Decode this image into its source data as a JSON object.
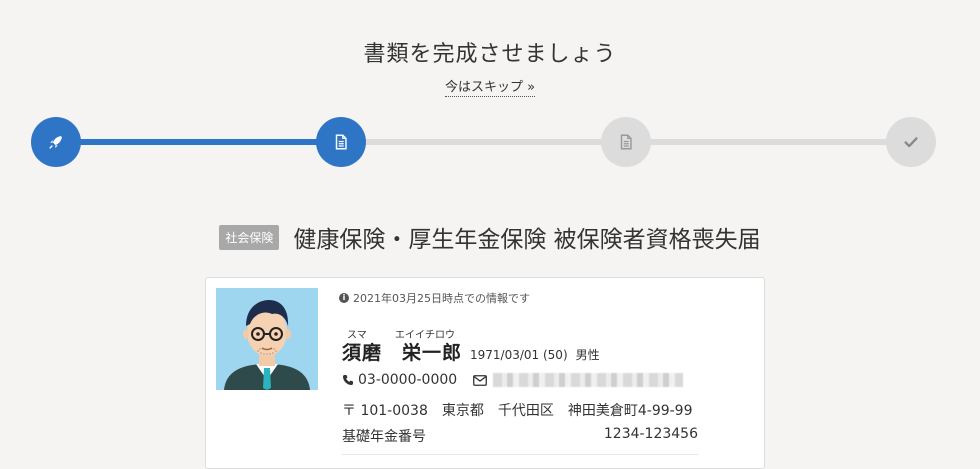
{
  "header": {
    "title": "書類を完成させましょう",
    "skip_label": "今はスキップ »"
  },
  "stepper": {
    "accent_color": "#2f75c6",
    "inactive_color": "#dcdcdc",
    "progress": 0.333,
    "steps": [
      {
        "icon": "rocket-icon",
        "state": "active"
      },
      {
        "icon": "document-icon",
        "state": "active"
      },
      {
        "icon": "document-icon",
        "state": "inactive"
      },
      {
        "icon": "check-icon",
        "state": "inactive"
      }
    ]
  },
  "document": {
    "badge": "社会保険",
    "title": "健康保険・厚生年金保険 被保険者資格喪失届"
  },
  "person": {
    "info_note": "2021年03月25日時点での情報です",
    "furigana_last": "スマ",
    "furigana_first": "エイイチロウ",
    "name": "須磨　栄一郎",
    "birth": "1971/03/01 (50)",
    "gender": "男性",
    "phone": "03-0000-0000",
    "postal_code": "〒 101-0038",
    "prefecture": "東京都",
    "city": "千代田区",
    "street": "神田美倉町4-99-99",
    "pension_label": "基礎年金番号",
    "pension_number": "1234-123456"
  }
}
